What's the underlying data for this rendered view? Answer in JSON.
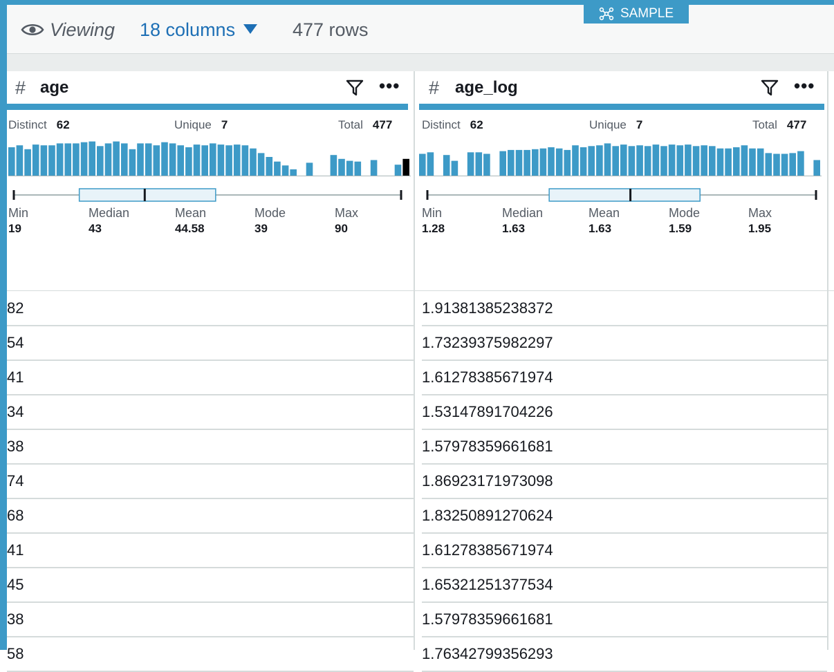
{
  "toolbar": {
    "viewing_label": "Viewing",
    "columns_label": "18 columns",
    "rows_label": "477 rows",
    "sample_label": "SAMPLE"
  },
  "colors": {
    "accent": "#3d9ac7",
    "link": "#1d6fb5",
    "highlight_bar": "#000000"
  },
  "columns": [
    {
      "type_icon": "#",
      "name": "age",
      "distinct_label": "Distinct",
      "distinct": "62",
      "unique_label": "Unique",
      "unique": "7",
      "total_label": "Total",
      "total": "477",
      "histogram": [
        0.75,
        0.8,
        0.7,
        0.82,
        0.8,
        0.8,
        0.85,
        0.85,
        0.85,
        0.88,
        0.9,
        0.78,
        0.85,
        0.9,
        0.85,
        0.7,
        0.85,
        0.85,
        0.8,
        0.88,
        0.85,
        0.8,
        0.75,
        0.82,
        0.8,
        0.85,
        0.82,
        0.8,
        0.82,
        0.8,
        0.72,
        0.6,
        0.5,
        0.38,
        0.28,
        0.18,
        0,
        0.35,
        0,
        0,
        0.55,
        0.45,
        0.4,
        0.38,
        0,
        0.42,
        0,
        0,
        0.3,
        0.45
      ],
      "highlight_bins": [
        44,
        49
      ],
      "box": {
        "min": 19,
        "q1": 31,
        "median": 43,
        "q3": 56,
        "max": 90
      },
      "stats": [
        {
          "label": "Min",
          "value": "19"
        },
        {
          "label": "Median",
          "value": "43"
        },
        {
          "label": "Mean",
          "value": "44.58"
        },
        {
          "label": "Mode",
          "value": "39"
        },
        {
          "label": "Max",
          "value": "90"
        }
      ],
      "values": [
        "82",
        "54",
        "41",
        "34",
        "38",
        "74",
        "68",
        "41",
        "45",
        "38",
        "58"
      ]
    },
    {
      "type_icon": "#",
      "name": "age_log",
      "distinct_label": "Distinct",
      "distinct": "62",
      "unique_label": "Unique",
      "unique": "7",
      "total_label": "Total",
      "total": "477",
      "histogram": [
        0.58,
        0.62,
        0,
        0.55,
        0.4,
        0,
        0.62,
        0.62,
        0.58,
        0,
        0.65,
        0.68,
        0.68,
        0.68,
        0.7,
        0.72,
        0.75,
        0.72,
        0.68,
        0.8,
        0.75,
        0.78,
        0.8,
        0.85,
        0.78,
        0.82,
        0.78,
        0.8,
        0.78,
        0.82,
        0.78,
        0.82,
        0.8,
        0.82,
        0.78,
        0.8,
        0.78,
        0.72,
        0.72,
        0.75,
        0.8,
        0.72,
        0.72,
        0.6,
        0.58,
        0.58,
        0.6,
        0.65,
        0,
        0.42
      ],
      "highlight_bins": [],
      "box": {
        "min": 1.28,
        "q1": 1.49,
        "median": 1.63,
        "q3": 1.75,
        "max": 1.95
      },
      "stats": [
        {
          "label": "Min",
          "value": "1.28"
        },
        {
          "label": "Median",
          "value": "1.63"
        },
        {
          "label": "Mean",
          "value": "1.63"
        },
        {
          "label": "Mode",
          "value": "1.59"
        },
        {
          "label": "Max",
          "value": "1.95"
        }
      ],
      "values": [
        "1.91381385238372",
        "1.73239375982297",
        "1.61278385671974",
        "1.53147891704226",
        "1.57978359661681",
        "1.86923171973098",
        "1.83250891270624",
        "1.61278385671974",
        "1.65321251377534",
        "1.57978359661681",
        "1.76342799356293"
      ]
    }
  ]
}
